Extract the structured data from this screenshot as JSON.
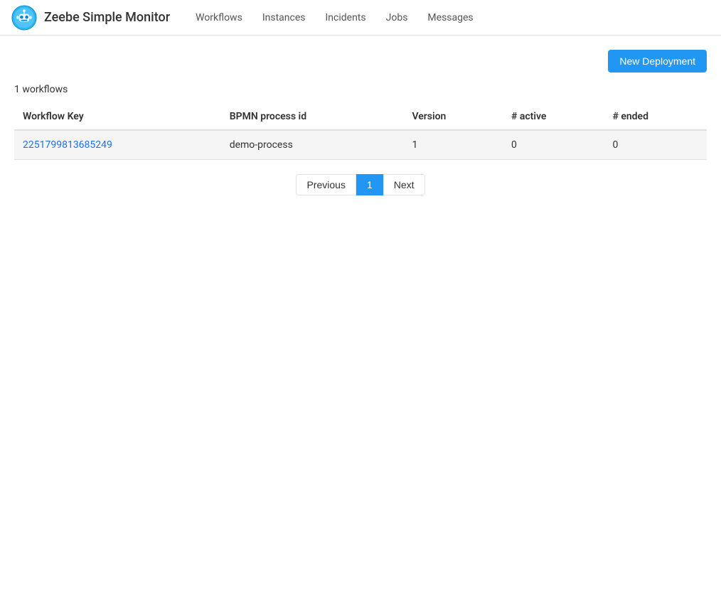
{
  "app": {
    "title": "Zeebe Simple Monitor"
  },
  "navbar": {
    "brand": "Zeebe Simple Monitor",
    "links": [
      {
        "label": "Workflows",
        "href": "#"
      },
      {
        "label": "Instances",
        "href": "#"
      },
      {
        "label": "Incidents",
        "href": "#"
      },
      {
        "label": "Jobs",
        "href": "#"
      },
      {
        "label": "Messages",
        "href": "#"
      }
    ]
  },
  "toolbar": {
    "new_deployment_label": "New Deployment"
  },
  "workflows_count": "1 workflows",
  "table": {
    "headers": [
      "Workflow Key",
      "BPMN process id",
      "Version",
      "# active",
      "# ended"
    ],
    "rows": [
      {
        "workflow_key": "2251799813685249",
        "bpmn_process_id": "demo-process",
        "version": "1",
        "active": "0",
        "ended": "0"
      }
    ]
  },
  "pagination": {
    "previous_label": "Previous",
    "next_label": "Next",
    "current_page": "1"
  }
}
